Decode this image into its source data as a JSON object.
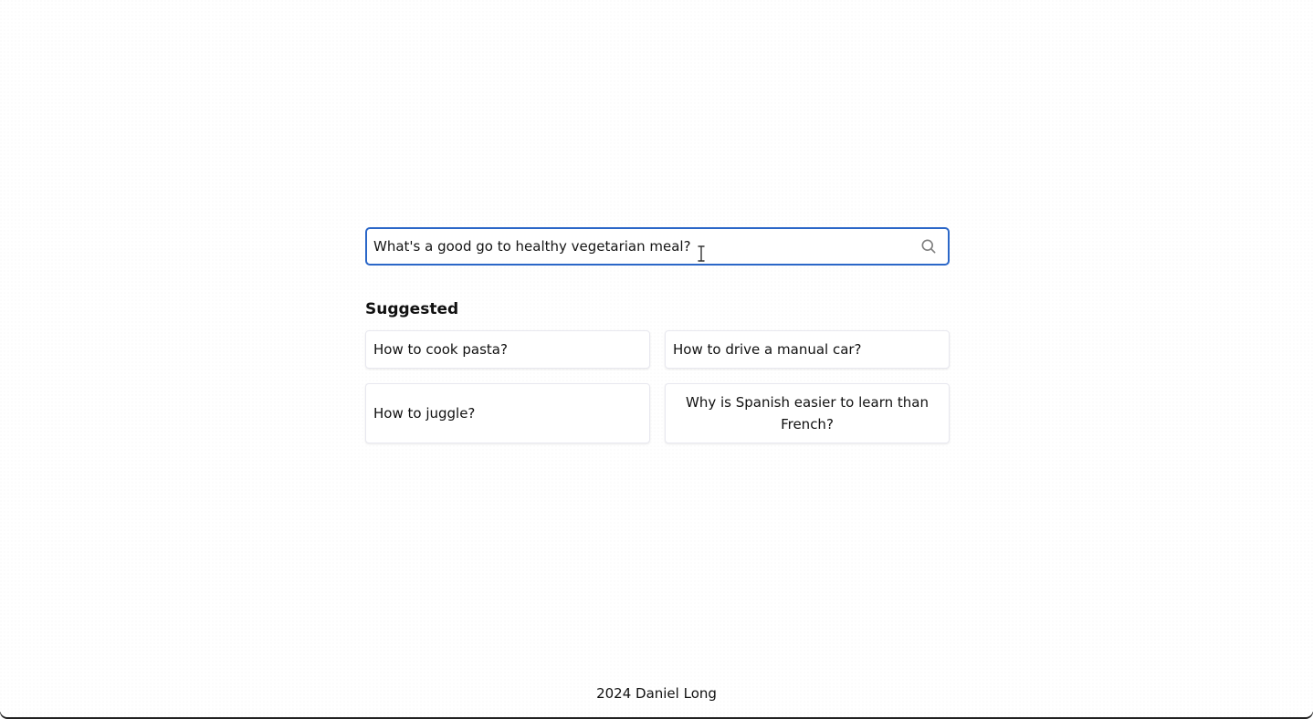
{
  "search": {
    "value": "What's a good go to healthy vegetarian meal?",
    "placeholder": ""
  },
  "icons": {
    "search": "search-icon",
    "cursor": "text-cursor-icon"
  },
  "colors": {
    "accent": "#2b67c8",
    "background": "#ffffff",
    "text": "#111111",
    "muted_icon": "#808080"
  },
  "suggested": {
    "title": "Suggested",
    "items": [
      {
        "label": "How to cook pasta?"
      },
      {
        "label": "How to drive a manual car?"
      },
      {
        "label": "How to juggle?"
      },
      {
        "label": "Why is Spanish easier to learn than French?"
      }
    ]
  },
  "footer": {
    "text": "2024 Daniel Long"
  }
}
